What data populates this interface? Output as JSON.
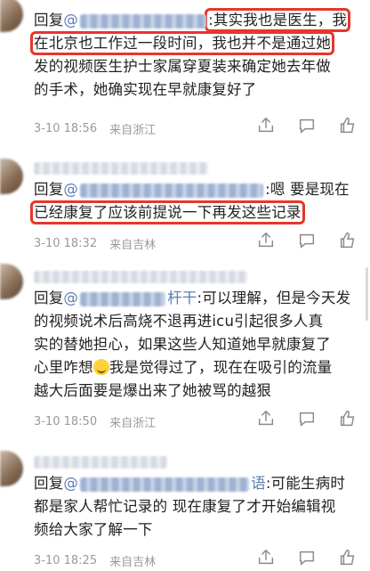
{
  "comments": [
    {
      "reply_prefix": "回复",
      "mention": "@",
      "mention_suffix": "",
      "text_hl": ":其实我也是医生，我",
      "text_hl2": "在北京也工作过一段时间，我也并不是通过她",
      "text_rest1": "发的视频医生护士家属穿夏装来确定她去年做",
      "text_rest2": "的手术，她确实现在早就康复好了",
      "date": "3-10 18:56",
      "location": "来自浙江"
    },
    {
      "reply_prefix": "回复",
      "mention": "@",
      "text_after_mention": ":嗯 要是现在",
      "text_hl": "已经康复了应该前提说一下再发这些记录",
      "date": "3-10 18:32",
      "location": "来自吉林"
    },
    {
      "reply_prefix": "回复",
      "mention": "@",
      "mention_suffix": "杆干",
      "text_l1": ":可以理解，但是今天发",
      "text_l2": "的视频说术后高烧不退再进icu引起很多人真",
      "text_l3": "实的替她担心，如果这些人知道她早就康复了",
      "text_l4a": "心里咋想",
      "text_l4b": "我是觉得过了，现在在吸引的流量",
      "text_l5": "越大后面要是爆出来了她被骂的越狠",
      "date": "3-10 18:50",
      "location": "来自浙江"
    },
    {
      "reply_prefix": "回复",
      "mention": "@",
      "mention_suffix": "语",
      "text_l1": ":可能生病时",
      "text_l2": "都是家人帮忙记录的 现在康复了才开始编辑视",
      "text_l3": "频给大家了解一下",
      "date": "3-10 18:25",
      "location": "来自吉林"
    }
  ],
  "icons": [
    "share-icon",
    "comment-icon",
    "like-icon"
  ],
  "colors": {
    "highlight_box": "#e8362a",
    "mention": "#5b7db5",
    "meta": "#9a9a9a"
  }
}
